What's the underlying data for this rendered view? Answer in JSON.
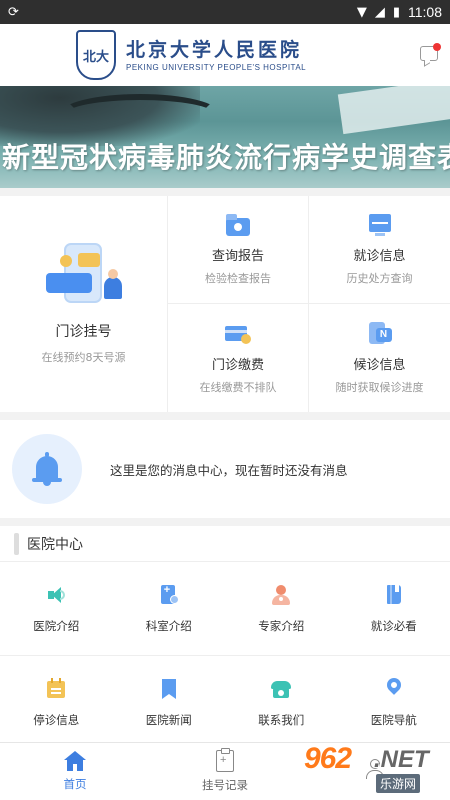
{
  "status_bar": {
    "time": "11:08"
  },
  "header": {
    "logo_emblem": "北大",
    "title_cn": "北京大学人民医院",
    "title_en": "PEKING UNIVERSITY PEOPLE'S HOSPITAL"
  },
  "banner": {
    "title": "新型冠状病毒肺炎流行病学史调查表"
  },
  "services": {
    "primary": {
      "title": "门诊挂号",
      "sub": "在线预约8天号源",
      "icon": "phone-chat-doctor-icon"
    },
    "items": [
      {
        "title": "查询报告",
        "sub": "检验检查报告",
        "icon": "folder-icon"
      },
      {
        "title": "就诊信息",
        "sub": "历史处方查询",
        "icon": "monitor-icon"
      },
      {
        "title": "门诊缴费",
        "sub": "在线缴费不排队",
        "icon": "card-coin-icon"
      },
      {
        "title": "候诊信息",
        "sub": "随时获取候诊进度",
        "icon": "tablet-n-icon"
      }
    ]
  },
  "message_center": {
    "text": "这里是您的消息中心，现在暂时还没有消息"
  },
  "hospital_center": {
    "title": "医院中心",
    "items": [
      {
        "label": "医院介绍",
        "icon": "speaker-icon"
      },
      {
        "label": "科室介绍",
        "icon": "department-icon"
      },
      {
        "label": "专家介绍",
        "icon": "expert-icon"
      },
      {
        "label": "就诊必看",
        "icon": "book-icon"
      },
      {
        "label": "停诊信息",
        "icon": "calendar-icon"
      },
      {
        "label": "医院新闻",
        "icon": "bookmark-icon"
      },
      {
        "label": "联系我们",
        "icon": "telephone-icon"
      },
      {
        "label": "医院导航",
        "icon": "location-pin-icon"
      }
    ]
  },
  "tabbar": {
    "tabs": [
      {
        "label": "首页",
        "active": true
      },
      {
        "label": "挂号记录",
        "active": false
      },
      {
        "label": "",
        "active": false
      }
    ]
  },
  "watermark": {
    "num": "962",
    "net": ".NET",
    "cn": "乐游网"
  },
  "colors": {
    "accent": "#3d7ee0",
    "teal": "#3cc2b4",
    "brand_blue": "#2a4d8a"
  }
}
